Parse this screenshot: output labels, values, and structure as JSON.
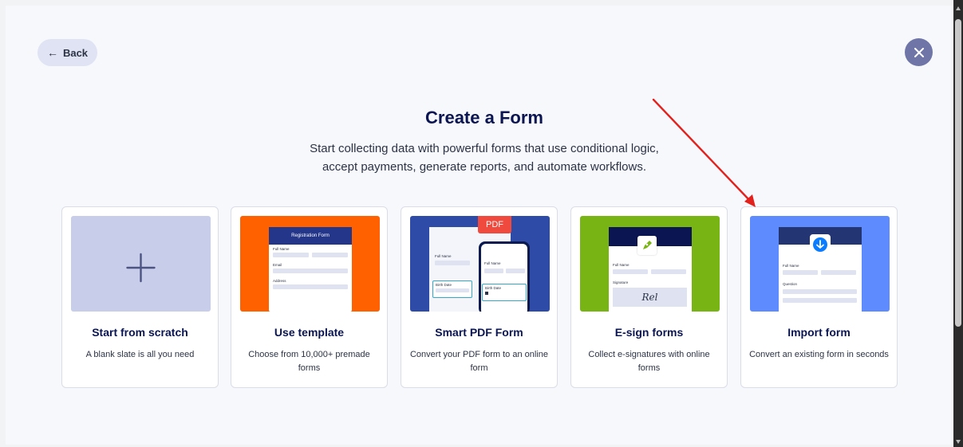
{
  "nav": {
    "back_label": "Back",
    "back_arrow": "←",
    "close_icon": "close-icon"
  },
  "header": {
    "title": "Create a Form",
    "subtitle_line1": "Start collecting data with powerful forms that use conditional logic,",
    "subtitle_line2": "accept payments, generate reports, and automate workflows."
  },
  "cards": [
    {
      "title": "Start from scratch",
      "desc": "A blank slate is all you need",
      "thumb_color": "#c8cde9"
    },
    {
      "title": "Use template",
      "desc": "Choose from 10,000+ premade forms",
      "thumb_color": "#ff6100",
      "thumb": {
        "form_title": "Registration Form",
        "field1": "Full Name",
        "field2": "Email",
        "field3": "Address"
      }
    },
    {
      "title": "Smart PDF Form",
      "desc": "Convert your PDF form to an online form",
      "thumb_color": "#2f4ba8",
      "thumb": {
        "pdf_badge": "PDF",
        "field1": "Full Name",
        "field2": "Birth Date",
        "phone_field1": "Full Name",
        "phone_field2": "Birth Date"
      }
    },
    {
      "title": "E-sign forms",
      "desc": "Collect e-signatures with online forms",
      "thumb_color": "#78b514",
      "thumb": {
        "field1": "Full Name",
        "field2": "Signature",
        "signature": "Rel"
      }
    },
    {
      "title": "Import form",
      "desc": "Convert an existing form in seconds",
      "thumb_color": "#5e8cff",
      "thumb": {
        "field1": "Full Name",
        "field2": "Question"
      }
    }
  ],
  "colors": {
    "accent_navy": "#0a1551",
    "arrow_red": "#e3211c"
  }
}
